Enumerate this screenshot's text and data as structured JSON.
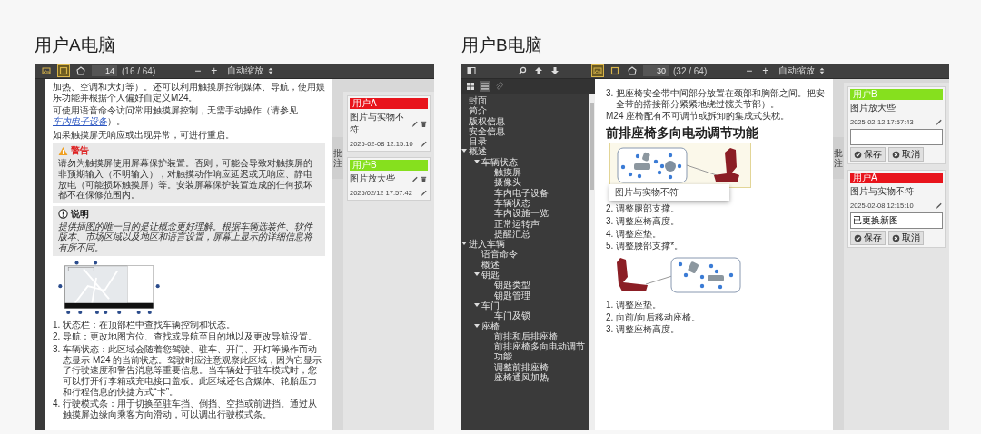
{
  "user_a": {
    "title": "用户A电脑",
    "toolbar": {
      "tools": [
        {
          "kind": "image",
          "selected": false
        },
        {
          "kind": "frame",
          "selected": true
        },
        {
          "kind": "stamp",
          "selected": false
        }
      ],
      "page_number": "14",
      "page_count": "(16 / 64)",
      "zoom_out": "−",
      "zoom_in": "+",
      "zoom": "自动缩放"
    },
    "document": [
      {
        "kind": "paragraph",
        "text": "加热、空调和大灯等）。还可以利用触摸屏控制媒体、导航，使用娱乐功能并根据个人偏好自定义M24。"
      },
      {
        "kind": "paragraph",
        "text": "可使用语音命令访问常用触摸屏控制，无需手动操作（请参见",
        "link": "车内电子设备",
        "after": "）。"
      },
      {
        "kind": "paragraph",
        "text": "如果触摸屏无响应或出现异常，可进行重启。"
      },
      {
        "kind": "warning",
        "title": "警告",
        "text": "请勿为触摸屏使用屏幕保护装置。否则，可能会导致对触摸屏的非预期输入（不明输入），对触摸动作响应延迟或无响应、静电放电（可能损坏触摸屏）等。安装屏幕保护装置造成的任何损坏都不在保修范围内。"
      },
      {
        "kind": "note",
        "title": "说明",
        "text": "提供插图的唯一目的是让概念更好理解。根据车辆选装件、软件版本、市场区域以及地区和语言设置，屏幕上显示的详细信息将有所不同。"
      },
      {
        "kind": "figure",
        "figure": {
          "kind": "touchscreen"
        }
      },
      {
        "kind": "list",
        "items": [
          {
            "number": "1.",
            "text": "状态栏：在顶部栏中查找车辆控制和状态。"
          },
          {
            "number": "2.",
            "text": "导航：更改地图方位、查找或导航至目的地以及更改导航设置。"
          },
          {
            "number": "3.",
            "text": "车辆状态：此区域会随着您驾驶、驻车、开门、开灯等操作而动态显示 M24 的当前状态。驾驶时应注意观察此区域，因为它显示了行驶速度和警告消息等重要信息。当车辆处于驻车模式时，您可以打开行李箱或充电接口盖板。此区域还包含媒体、轮胎压力和行程信息的快捷方式“卡”。"
          },
          {
            "number": "4.",
            "text": "行驶模式条：用于切换至驻车挡、倒挡、空挡或前进挡。通过从触摸屏边缘向乘客方向滑动，可以调出行驶模式条。"
          }
        ]
      }
    ],
    "comments_tab": "批注",
    "comments": [
      {
        "kind": "view",
        "user": "用户A",
        "color": "#e8141c",
        "text": "图片与实物不符",
        "time": "2025-02-08 12:15:10"
      },
      {
        "kind": "view",
        "user": "用户B",
        "color": "#86e01e",
        "text": "图片放大些",
        "time": "2025/02/12 17:57:42"
      }
    ]
  },
  "user_b": {
    "title": "用户B电脑",
    "toolbar": {
      "tools": [
        {
          "kind": "image",
          "selected": true
        },
        {
          "kind": "frame",
          "selected": false
        },
        {
          "kind": "stamp",
          "selected": false
        }
      ],
      "page_number": "30",
      "page_count": "(32 / 64)",
      "zoom_out": "−",
      "zoom_in": "+",
      "zoom": "自动缩放"
    },
    "sidebar": {
      "tabs": [
        {
          "kind": "thumbnails",
          "selected": false
        },
        {
          "kind": "outline",
          "selected": true
        },
        {
          "kind": "attachments",
          "selected": false
        }
      ],
      "outline": [
        {
          "label": "封面"
        },
        {
          "label": "简介"
        },
        {
          "label": "版权信息"
        },
        {
          "label": "安全信息"
        },
        {
          "label": "目录"
        },
        {
          "label": "概述",
          "expanded": true,
          "children": [
            {
              "label": "车辆状态",
              "expanded": true,
              "children": [
                {
                  "label": "触摸屏"
                },
                {
                  "label": "摄像头"
                },
                {
                  "label": "车内电子设备"
                },
                {
                  "label": "车辆状态"
                },
                {
                  "label": "车内设施一览"
                },
                {
                  "label": "正常运转声"
                },
                {
                  "label": "提醒汇总"
                }
              ]
            }
          ]
        },
        {
          "label": "进入车辆",
          "expanded": true,
          "children": [
            {
              "label": "语音命令"
            },
            {
              "label": "概述"
            },
            {
              "label": "钥匙",
              "expanded": true,
              "children": [
                {
                  "label": "钥匙类型"
                },
                {
                  "label": "钥匙管理"
                }
              ]
            },
            {
              "label": "车门",
              "expanded": true,
              "children": [
                {
                  "label": "车门及锁"
                }
              ]
            },
            {
              "label": "座椅",
              "expanded": true,
              "children": [
                {
                  "label": "前排和后排座椅"
                },
                {
                  "label": "前排座椅多向电动调节功能"
                },
                {
                  "label": "调整前排座椅"
                },
                {
                  "label": "座椅通风加热"
                }
              ]
            }
          ]
        }
      ]
    },
    "document": [
      {
        "kind": "list",
        "items": [
          {
            "number": "3.",
            "text": "把座椅安全带中间部分放置在颈部和胸部之间。把安全带的搭接部分紧紧地绕过髋关节部）。"
          }
        ]
      },
      {
        "kind": "paragraph",
        "text": "M24 座椅配有不可调节或拆卸的集成式头枕。"
      },
      {
        "kind": "heading",
        "text": "前排座椅多向电动调节功能"
      },
      {
        "kind": "figure",
        "figure": {
          "kind": "seat_front"
        },
        "highlighted": true,
        "annotation": "图片与实物不符"
      },
      {
        "kind": "list",
        "items": [
          {
            "number": "2.",
            "text": "调整腿部支撑。"
          },
          {
            "number": "3.",
            "text": "调整座椅高度。"
          },
          {
            "number": "4.",
            "text": "调整座垫。"
          },
          {
            "number": "5.",
            "text": "调整腰部支撑*。"
          }
        ]
      },
      {
        "kind": "figure",
        "figure": {
          "kind": "seat_side"
        }
      },
      {
        "kind": "list",
        "items": [
          {
            "number": "1.",
            "text": "调整座垫。"
          },
          {
            "number": "2.",
            "text": "向前/向后移动座椅。"
          },
          {
            "number": "3.",
            "text": "调整座椅高度。"
          }
        ]
      }
    ],
    "comments_tab": "批注",
    "comments": [
      {
        "kind": "edit",
        "user": "用户B",
        "color": "#86e01e",
        "text": "图片放大些",
        "time": "2025-02-12 17:57:43",
        "save": "保存",
        "cancel": "取消"
      },
      {
        "kind": "edit",
        "user": "用户A",
        "color": "#e8141c",
        "text": "图片与实物不符",
        "time": "2025-02-08 12:15:10",
        "reply": "已更换新图",
        "save": "保存",
        "cancel": "取消"
      }
    ]
  }
}
